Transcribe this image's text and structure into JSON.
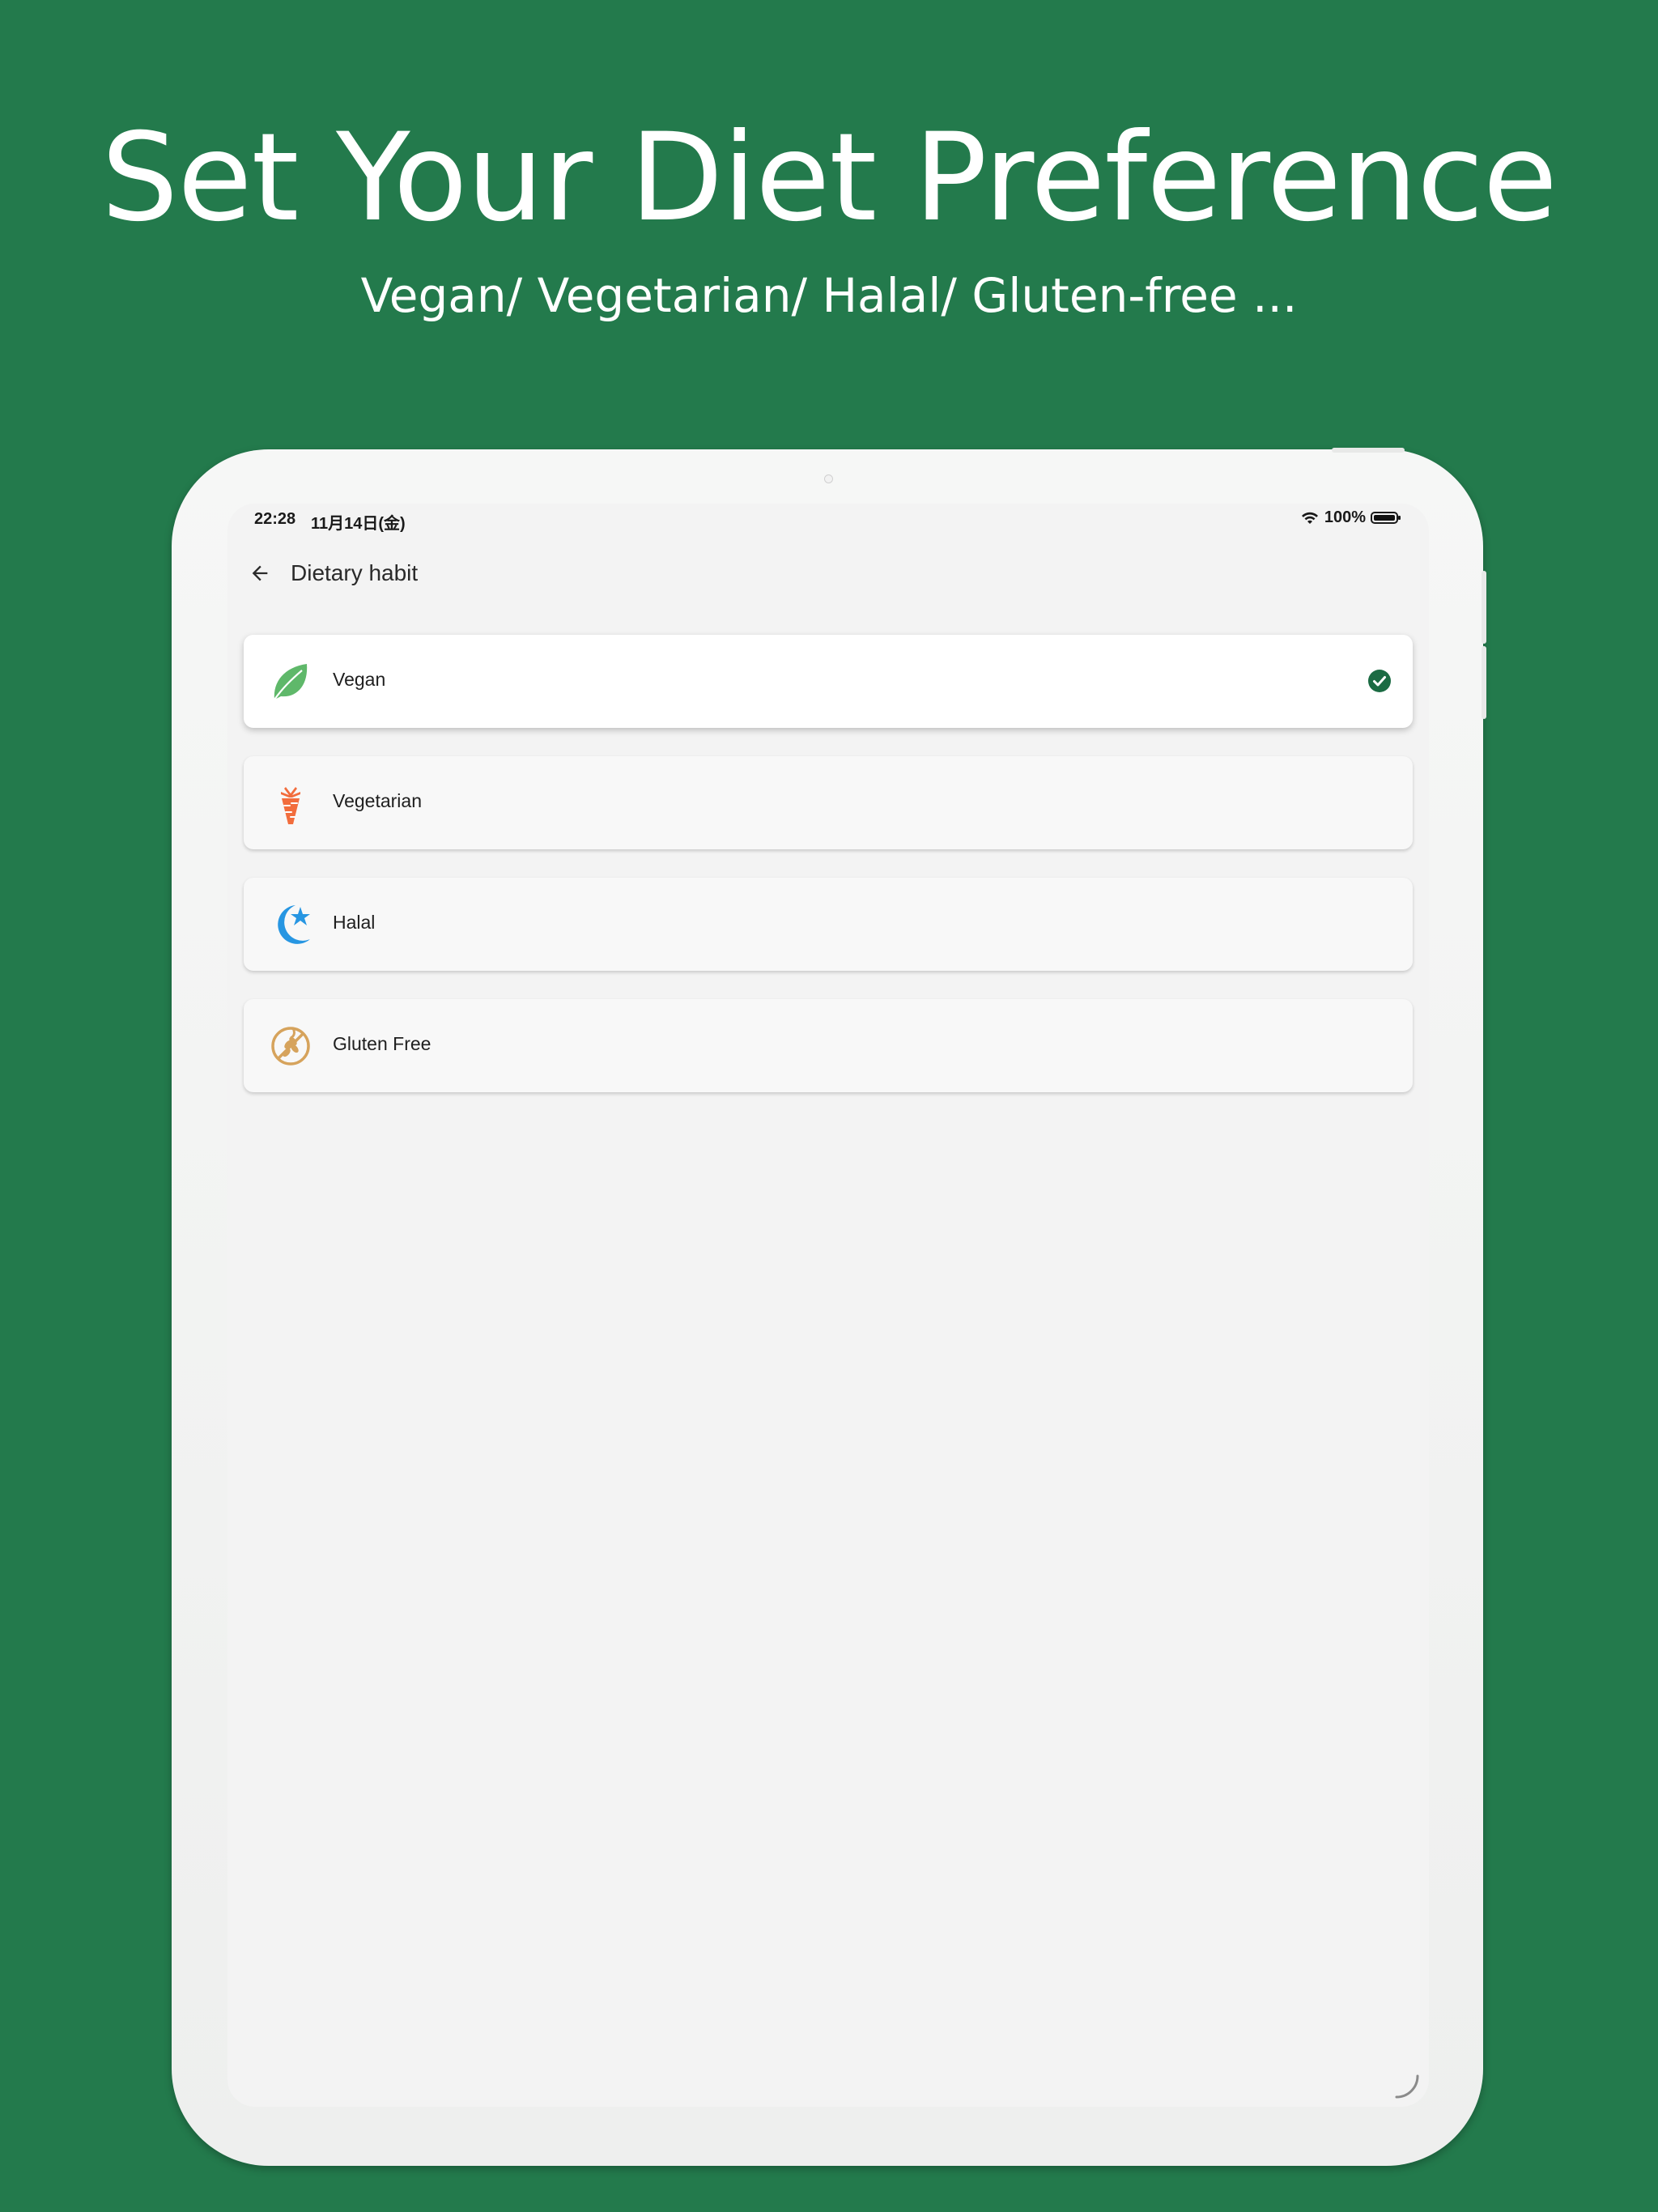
{
  "promo": {
    "title": "Set Your Diet Preference",
    "subtitle": "Vegan/ Vegetarian/ Halal/ Gluten-free ..."
  },
  "status_bar": {
    "time": "22:28",
    "date": "11月14日(金)",
    "battery_percent": "100%"
  },
  "app_bar": {
    "title": "Dietary habit"
  },
  "options": [
    {
      "label": "Vegan",
      "icon": "leaf-icon",
      "selected": true
    },
    {
      "label": "Vegetarian",
      "icon": "carrot-icon",
      "selected": false
    },
    {
      "label": "Halal",
      "icon": "crescent-star-icon",
      "selected": false
    },
    {
      "label": "Gluten Free",
      "icon": "no-wheat-icon",
      "selected": false
    }
  ],
  "colors": {
    "background": "#237a4c",
    "check": "#1b6b43",
    "leaf": "#5fb86a",
    "carrot": "#f26d3d",
    "halal": "#2796e2",
    "gluten": "#d6a35c"
  }
}
